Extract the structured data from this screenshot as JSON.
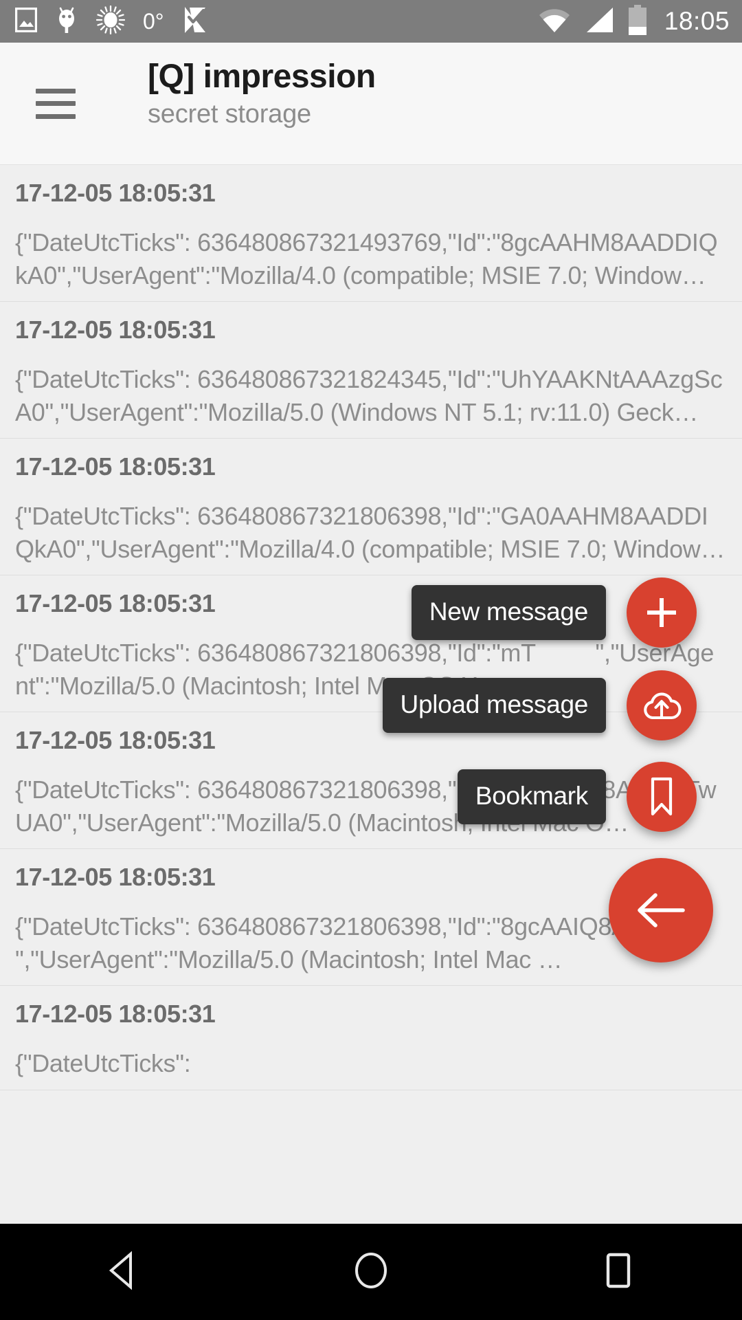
{
  "status_bar": {
    "icons": [
      "image-icon",
      "android-bug-icon",
      "brightness-icon",
      "checkmark-flag-icon",
      "wifi-icon",
      "signal-icon",
      "battery-icon"
    ],
    "temperature": "0°",
    "clock": "18:05",
    "background_color": "#7d7d7d"
  },
  "app_bar": {
    "menu_icon": "hamburger-icon",
    "title": "[Q] impression",
    "subtitle": "secret storage",
    "background_color": "#f7f7f7"
  },
  "list": {
    "items": [
      {
        "date": "17-12-05 18:05:31",
        "body": "{\"DateUtcTicks\": 636480867321493769,\"Id\":\"8gcAAHM8AADDIQkA0\",\"UserAgent\":\"Mozilla/4.0 (compatible; MSIE 7.0; Window…"
      },
      {
        "date": "17-12-05 18:05:31",
        "body": "{\"DateUtcTicks\": 636480867321824345,\"Id\":\"UhYAAKNtAAAzgScA0\",\"UserAgent\":\"Mozilla/5.0 (Windows NT 5.1; rv:11.0) Geck…"
      },
      {
        "date": "17-12-05 18:05:31",
        "body": "{\"DateUtcTicks\": 636480867321806398,\"Id\":\"GA0AAHM8AADDIQkA0\",\"UserAgent\":\"Mozilla/4.0 (compatible; MSIE 7.0; Window…"
      },
      {
        "date": "17-12-05 18:05:31",
        "body": "{\"DateUtcTicks\": 636480867321806398,\"Id\":\"mT         \",\"UserAgent\":\"Mozilla/5.0 (Macintosh; Intel Mac OS X…"
      },
      {
        "date": "17-12-05 18:05:31",
        "body": "{\"DateUtcTicks\": 636480867321806398,\"Id\":\"7xwAAIQ8AABmTwUA0\",\"UserAgent\":\"Mozilla/5.0 (Macintosh; Intel Mac O…"
      },
      {
        "date": "17-12-05 18:05:31",
        "body": "{\"DateUtcTicks\": 636480867321806398,\"Id\":\"8gcAAIQ8AABmT       \",\"UserAgent\":\"Mozilla/5.0 (Macintosh; Intel Mac …"
      },
      {
        "date": "17-12-05 18:05:31",
        "body": "{\"DateUtcTicks\":"
      }
    ],
    "background_color": "#efefef",
    "divider_color": "#dedede"
  },
  "fab_menu": {
    "expanded": true,
    "accent_color": "#d8412f",
    "label_background": "#333333",
    "actions": [
      {
        "label": "New message",
        "icon": "plus-icon"
      },
      {
        "label": "Upload message",
        "icon": "cloud-upload-icon"
      },
      {
        "label": "Bookmark",
        "icon": "bookmark-icon"
      }
    ],
    "main": {
      "icon": "arrow-left-icon",
      "label": "close-fab-menu"
    }
  },
  "nav_bar": {
    "background_color": "#000000",
    "buttons": [
      {
        "name": "back",
        "icon": "triangle-back-icon"
      },
      {
        "name": "home",
        "icon": "circle-home-icon"
      },
      {
        "name": "recents",
        "icon": "square-recents-icon"
      }
    ]
  }
}
